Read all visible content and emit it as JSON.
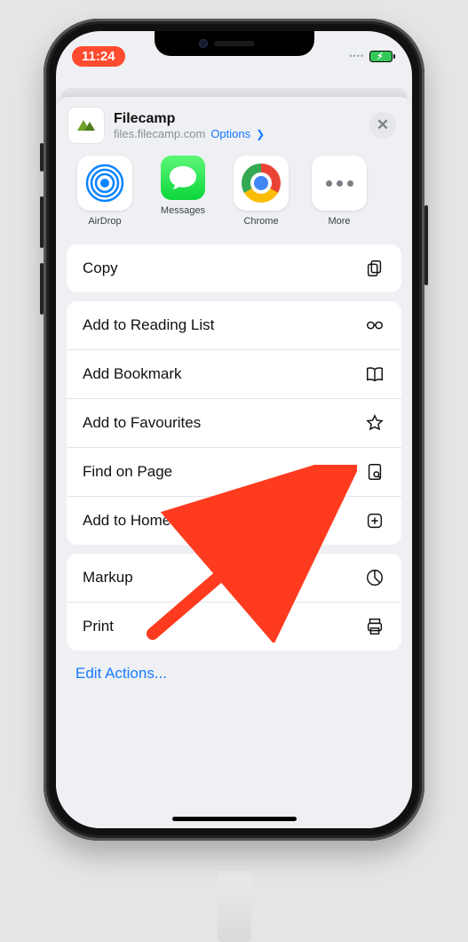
{
  "statusbar": {
    "time": "11:24"
  },
  "sheet": {
    "site_title": "Filecamp",
    "site_domain": "files.filecamp.com",
    "options_label": "Options"
  },
  "apps": [
    {
      "name": "airdrop",
      "label": "AirDrop"
    },
    {
      "name": "messages",
      "label": "Messages"
    },
    {
      "name": "chrome",
      "label": "Chrome"
    },
    {
      "name": "more",
      "label": "More"
    }
  ],
  "group1": [
    {
      "name": "copy",
      "label": "Copy"
    }
  ],
  "group2": [
    {
      "name": "reading-list",
      "label": "Add to Reading List"
    },
    {
      "name": "bookmark",
      "label": "Add Bookmark"
    },
    {
      "name": "favourites",
      "label": "Add to Favourites"
    },
    {
      "name": "find-on-page",
      "label": "Find on Page"
    },
    {
      "name": "home-screen",
      "label": "Add to Home Screen"
    }
  ],
  "group3": [
    {
      "name": "markup",
      "label": "Markup"
    },
    {
      "name": "print",
      "label": "Print"
    }
  ],
  "edit_actions_label": "Edit Actions..."
}
